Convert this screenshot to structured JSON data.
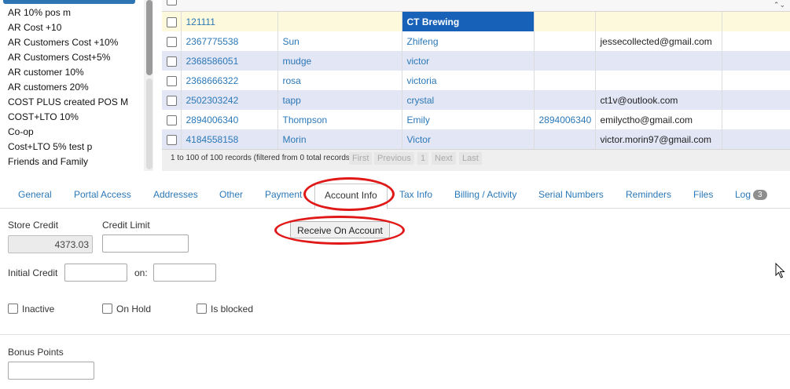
{
  "left_list": {
    "items": [
      "AR 10% pos m",
      "AR Cost +10",
      "AR Customers Cost +10%",
      "AR Customers Cost+5%",
      "AR customer 10%",
      "AR customers 20%",
      "COST PLUS created POS M",
      "COST+LTO 10%",
      "Co-op",
      "Cost+LTO 5% test p",
      "Friends and Family"
    ]
  },
  "grid": {
    "rows": [
      {
        "id": "121111",
        "last": "",
        "first": "CT Brewing",
        "phone": "",
        "email": ""
      },
      {
        "id": "2367775538",
        "last": "Sun",
        "first": "Zhifeng",
        "phone": "",
        "email": "jessecollected@gmail.com"
      },
      {
        "id": "2368586051",
        "last": "mudge",
        "first": "victor",
        "phone": "",
        "email": ""
      },
      {
        "id": "2368666322",
        "last": "rosa",
        "first": "victoria",
        "phone": "",
        "email": ""
      },
      {
        "id": "2502303242",
        "last": "tapp",
        "first": "crystal",
        "phone": "",
        "email": "ct1v@outlook.com"
      },
      {
        "id": "2894006340",
        "last": "Thompson",
        "first": "Emily",
        "phone": "2894006340",
        "email": "emilyctho@gmail.com"
      },
      {
        "id": "4184558158",
        "last": "Morin",
        "first": "Victor",
        "phone": "",
        "email": "victor.morin97@gmail.com"
      }
    ],
    "pager": {
      "info": "1 to 100 of 100 records (filtered from 0 total records)",
      "first": "First",
      "previous": "Previous",
      "page": "1",
      "next": "Next",
      "last": "Last"
    }
  },
  "tabs": {
    "general": "General",
    "portal_access": "Portal Access",
    "addresses": "Addresses",
    "other": "Other",
    "payment": "Payment",
    "account_info": "Account Info",
    "tax_info": "Tax Info",
    "billing_activity": "Billing / Activity",
    "serial_numbers": "Serial Numbers",
    "reminders": "Reminders",
    "files": "Files",
    "log": "Log",
    "log_count": "3"
  },
  "form": {
    "store_credit_label": "Store Credit",
    "store_credit_value": "4373.03",
    "credit_limit_label": "Credit Limit",
    "credit_limit_value": "",
    "receive_button": "Receive On Account",
    "initial_credit_label": "Initial Credit",
    "initial_credit_value": "",
    "on_label": "on:",
    "on_value": "",
    "inactive_label": "Inactive",
    "on_hold_label": "On Hold",
    "is_blocked_label": "Is blocked",
    "bonus_points_label": "Bonus Points",
    "bonus_points_value": ""
  },
  "colors": {
    "link": "#2b78b8",
    "selected_cell": "#1762b8",
    "highlight_ellipse": "#e01818",
    "row_alt": "#e3e6f5",
    "row_first": "#fdf9dc"
  }
}
